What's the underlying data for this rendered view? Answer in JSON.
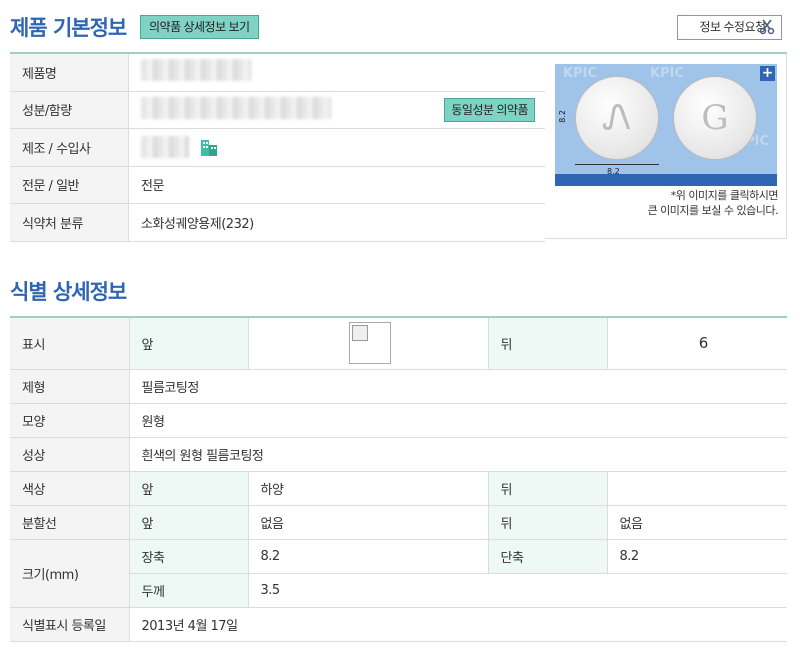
{
  "basic": {
    "title": "제품 기본정보",
    "detail_button": "의약품 상세정보 보기",
    "request_button": "정보 수정요청",
    "rows": [
      {
        "label": "제품명",
        "value": ""
      },
      {
        "label": "성분/함량",
        "value": "",
        "button": "동일성분 의약품"
      },
      {
        "label": "제조 / 수입사",
        "value": ""
      },
      {
        "label": "전문 / 일반",
        "value": "전문"
      },
      {
        "label": "식약처 분류",
        "value": "소화성궤양용제(232)"
      }
    ],
    "image": {
      "pill_left_mark": "Ꮑ",
      "pill_right_mark": "G",
      "dimension_bottom": "8.2",
      "dimension_side": "8.2",
      "watermark": "KPIC",
      "note_line1": "*위 이미지를 클릭하시면",
      "note_line2": "큰 이미지를 보실 수 있습니다."
    }
  },
  "identification": {
    "title": "식별 상세정보",
    "rows": {
      "mark": {
        "label": "표시",
        "front": "앞",
        "back": "뒤",
        "back_value": "6"
      },
      "form": {
        "label": "제형",
        "value": "필름코팅정"
      },
      "shape": {
        "label": "모양",
        "value": "원형"
      },
      "property": {
        "label": "성상",
        "value": "흰색의 원형 필름코팅정"
      },
      "color": {
        "label": "색상",
        "front": "앞",
        "front_value": "하양",
        "back": "뒤",
        "back_value": ""
      },
      "score": {
        "label": "분할선",
        "front": "앞",
        "front_value": "없음",
        "back": "뒤",
        "back_value": "없음"
      },
      "size": {
        "label": "크기(mm)",
        "long_label": "장축",
        "long_value": "8.2",
        "short_label": "단축",
        "short_value": "8.2",
        "thick_label": "두께",
        "thick_value": "3.5"
      },
      "date": {
        "label": "식별표시 등록일",
        "value": "2013년 4월 17일"
      }
    }
  },
  "colors": {
    "accent": "#2f66b3",
    "teal": "#7fd3c4",
    "border_top": "#9bd2c5"
  }
}
